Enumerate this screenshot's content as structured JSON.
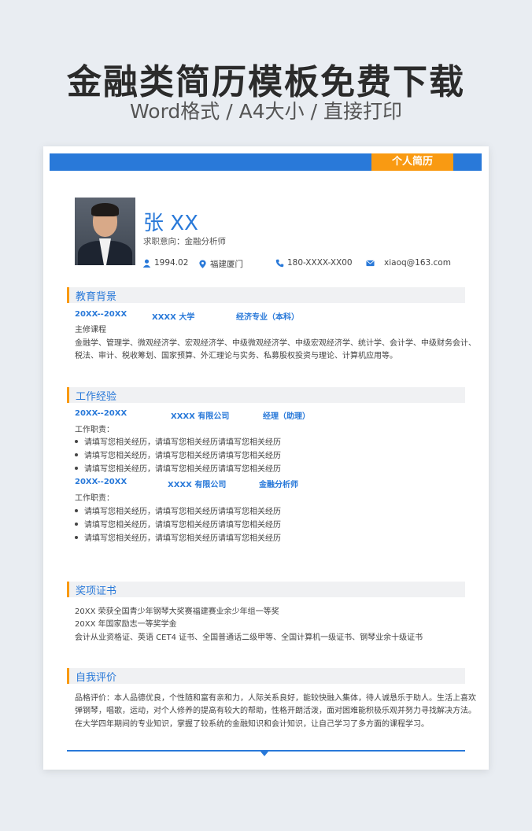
{
  "banner": {
    "title": "金融类简历模板免费下载",
    "subtitle": "Word格式 / A4大小 / 直接打印"
  },
  "resume": {
    "tag": "个人简历",
    "name": "张 XX",
    "intent": "求职意向：金融分析师",
    "contacts": {
      "birth": "1994.02",
      "location": "福建厦门",
      "phone": "180-XXXX-XX00",
      "email": "xiaoq@163.com"
    },
    "education": {
      "title": "教育背景",
      "period": "20XX--20XX",
      "school": "XXXX 大学",
      "major": "经济专业（本科）",
      "course_label": "主修课程",
      "courses_line1": "金融学、管理学、微观经济学、宏观经济学、中级微观经济学、中级宏观经济学、统计学、会计学、中级财务会计、",
      "courses_line2": "税法、审计、税收筹划、国家预算、外汇理论与实务、私募股权投资与理论、计算机应用等。"
    },
    "work": {
      "title": "工作经验",
      "jobs": [
        {
          "period": "20XX--20XX",
          "company": "XXXX 有限公司",
          "position": "经理（助理）",
          "duty_label": "工作职责：",
          "duties": [
            "请填写您相关经历，请填写您相关经历请填写您相关经历",
            "请填写您相关经历，请填写您相关经历请填写您相关经历",
            "请填写您相关经历，请填写您相关经历请填写您相关经历"
          ]
        },
        {
          "period": "20XX--20XX",
          "company": "XXXX 有限公司",
          "position": "金融分析师",
          "duty_label": "工作职责：",
          "duties": [
            "请填写您相关经历，请填写您相关经历请填写您相关经历",
            "请填写您相关经历，请填写您相关经历请填写您相关经历",
            "请填写您相关经历，请填写您相关经历请填写您相关经历"
          ]
        }
      ]
    },
    "awards": {
      "title": "奖项证书",
      "items": [
        "20XX  荣获全国青少年钢琴大奖赛福建赛业余少年组一等奖",
        "20XX 年国家励志一等奖学金",
        "会计从业资格证、英语 CET4 证书、全国普通话二级甲等、全国计算机一级证书、钢琴业余十级证书"
      ]
    },
    "self": {
      "title": "自我评价",
      "lines": [
        "品格评价：本人品德优良，个性随和富有亲和力，人际关系良好，能较快融入集体，待人诚恳乐于助人。生活上喜欢",
        "弹钢琴，唱歌，运动，对个人修养的提高有较大的帮助，性格开朗活泼，面对困难能积极乐观并努力寻找解决方法。",
        "在大学四年期间的专业知识，掌握了较系统的金融知识和会计知识，让自己学习了多方面的课程学习。"
      ]
    }
  },
  "colors": {
    "accent": "#2979d9",
    "highlight": "#f99a12"
  }
}
